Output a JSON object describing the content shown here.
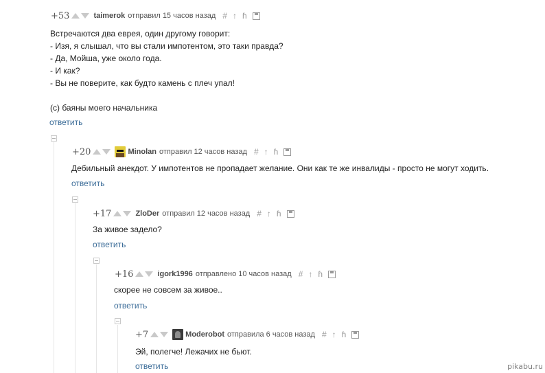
{
  "comments": [
    {
      "rating": "+53",
      "author": "taimerok",
      "action": "отправил",
      "time": "15 часов назад",
      "text": "Встречаются два еврея, один другому говорит:\n- Изя, я слышал, что вы стали импотентом, это таки правда?\n- Да, Мойша, уже около года.\n- И как?\n- Вы не поверите, как будто камень с плеч упал!\n\n(с) баяны моего начальника",
      "reply": "ответить"
    },
    {
      "rating": "+20",
      "author": "Minolan",
      "action": "отправил",
      "time": "12 часов назад",
      "text": "Дебильный анекдот. У импотентов не пропадает желание. Они как те же инвалиды - просто не могут ходить.",
      "reply": "ответить"
    },
    {
      "rating": "+17",
      "author": "ZloDer",
      "action": "отправил",
      "time": "12 часов назад",
      "text": "За живое задело?",
      "reply": "ответить"
    },
    {
      "rating": "+16",
      "author": "igork1996",
      "action": "отправлено",
      "time": "10 часов назад",
      "text": "скорее не совсем за живое..",
      "reply": "ответить"
    },
    {
      "rating": "+7",
      "author": "Moderobot",
      "action": "отправила",
      "time": "6 часов назад",
      "text": "Эй, полегче! Лежачих не бьют.",
      "reply": "ответить"
    }
  ],
  "tools": {
    "hash": "#",
    "up": "↑",
    "branch": "ɦ"
  },
  "watermark": "pikabu.ru",
  "icons": {
    "vote_up": "vote-up-arrow",
    "vote_down": "vote-down-arrow",
    "collapse": "collapse-minus-box",
    "save": "save-disk"
  },
  "colors": {
    "reply_link": "#3b6c98",
    "arrow_gray": "#c9c9c9",
    "tool_gray": "#9a9a9a"
  }
}
